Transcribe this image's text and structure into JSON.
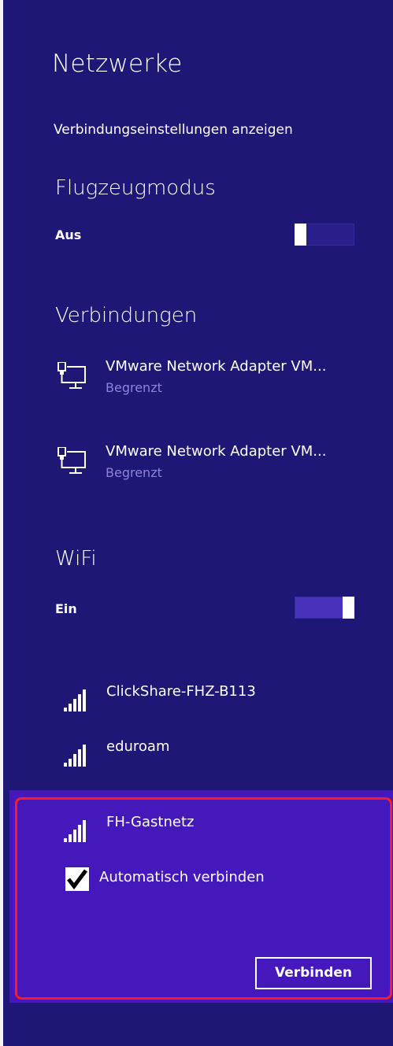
{
  "panel": {
    "title": "Netzwerke",
    "connection_settings_link": "Verbindungseinstellungen anzeigen"
  },
  "airplane_mode": {
    "title": "Flugzeugmodus",
    "state_label": "Aus",
    "enabled": false
  },
  "connections": {
    "title": "Verbindungen",
    "items": [
      {
        "name": "VMware Network Adapter VM...",
        "status": "Begrenzt",
        "icon": "wired-network-icon"
      },
      {
        "name": "VMware Network Adapter VM...",
        "status": "Begrenzt",
        "icon": "wired-network-icon"
      }
    ]
  },
  "wifi": {
    "title": "WiFi",
    "state_label": "Ein",
    "enabled": true,
    "networks": [
      {
        "name": "ClickShare-FHZ-B113",
        "icon": "wifi-signal-icon"
      },
      {
        "name": "eduroam",
        "icon": "wifi-signal-icon"
      },
      {
        "name": "FH-Gastnetz",
        "icon": "wifi-signal-icon"
      }
    ],
    "selected": {
      "auto_connect_label": "Automatisch verbinden",
      "auto_connect_checked": true,
      "connect_button_label": "Verbinden"
    }
  },
  "colors": {
    "panel_background": "#1d1776",
    "selected_background": "#4518bb",
    "highlight_border": "#ff1c21",
    "secondary_text": "#8f83d8"
  }
}
